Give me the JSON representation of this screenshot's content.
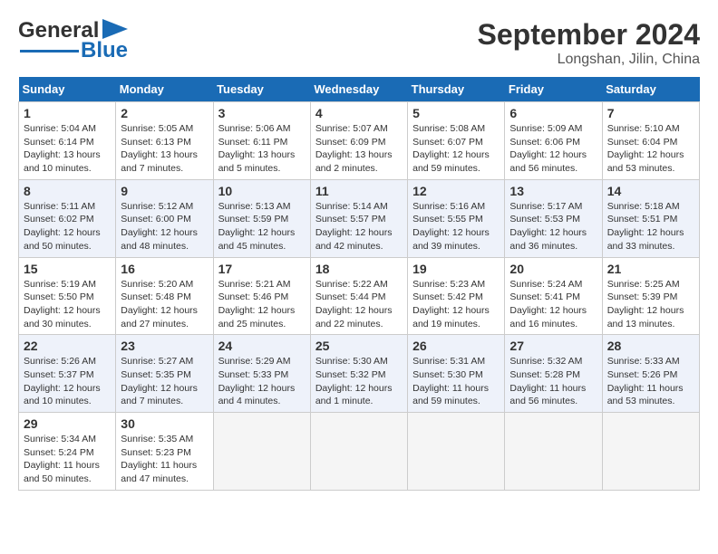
{
  "header": {
    "logo_main": "General",
    "logo_sub": "Blue",
    "month_title": "September 2024",
    "location": "Longshan, Jilin, China"
  },
  "days_of_week": [
    "Sunday",
    "Monday",
    "Tuesday",
    "Wednesday",
    "Thursday",
    "Friday",
    "Saturday"
  ],
  "weeks": [
    [
      {
        "day": 1,
        "info": "Sunrise: 5:04 AM\nSunset: 6:14 PM\nDaylight: 13 hours\nand 10 minutes."
      },
      {
        "day": 2,
        "info": "Sunrise: 5:05 AM\nSunset: 6:13 PM\nDaylight: 13 hours\nand 7 minutes."
      },
      {
        "day": 3,
        "info": "Sunrise: 5:06 AM\nSunset: 6:11 PM\nDaylight: 13 hours\nand 5 minutes."
      },
      {
        "day": 4,
        "info": "Sunrise: 5:07 AM\nSunset: 6:09 PM\nDaylight: 13 hours\nand 2 minutes."
      },
      {
        "day": 5,
        "info": "Sunrise: 5:08 AM\nSunset: 6:07 PM\nDaylight: 12 hours\nand 59 minutes."
      },
      {
        "day": 6,
        "info": "Sunrise: 5:09 AM\nSunset: 6:06 PM\nDaylight: 12 hours\nand 56 minutes."
      },
      {
        "day": 7,
        "info": "Sunrise: 5:10 AM\nSunset: 6:04 PM\nDaylight: 12 hours\nand 53 minutes."
      }
    ],
    [
      {
        "day": 8,
        "info": "Sunrise: 5:11 AM\nSunset: 6:02 PM\nDaylight: 12 hours\nand 50 minutes."
      },
      {
        "day": 9,
        "info": "Sunrise: 5:12 AM\nSunset: 6:00 PM\nDaylight: 12 hours\nand 48 minutes."
      },
      {
        "day": 10,
        "info": "Sunrise: 5:13 AM\nSunset: 5:59 PM\nDaylight: 12 hours\nand 45 minutes."
      },
      {
        "day": 11,
        "info": "Sunrise: 5:14 AM\nSunset: 5:57 PM\nDaylight: 12 hours\nand 42 minutes."
      },
      {
        "day": 12,
        "info": "Sunrise: 5:16 AM\nSunset: 5:55 PM\nDaylight: 12 hours\nand 39 minutes."
      },
      {
        "day": 13,
        "info": "Sunrise: 5:17 AM\nSunset: 5:53 PM\nDaylight: 12 hours\nand 36 minutes."
      },
      {
        "day": 14,
        "info": "Sunrise: 5:18 AM\nSunset: 5:51 PM\nDaylight: 12 hours\nand 33 minutes."
      }
    ],
    [
      {
        "day": 15,
        "info": "Sunrise: 5:19 AM\nSunset: 5:50 PM\nDaylight: 12 hours\nand 30 minutes."
      },
      {
        "day": 16,
        "info": "Sunrise: 5:20 AM\nSunset: 5:48 PM\nDaylight: 12 hours\nand 27 minutes."
      },
      {
        "day": 17,
        "info": "Sunrise: 5:21 AM\nSunset: 5:46 PM\nDaylight: 12 hours\nand 25 minutes."
      },
      {
        "day": 18,
        "info": "Sunrise: 5:22 AM\nSunset: 5:44 PM\nDaylight: 12 hours\nand 22 minutes."
      },
      {
        "day": 19,
        "info": "Sunrise: 5:23 AM\nSunset: 5:42 PM\nDaylight: 12 hours\nand 19 minutes."
      },
      {
        "day": 20,
        "info": "Sunrise: 5:24 AM\nSunset: 5:41 PM\nDaylight: 12 hours\nand 16 minutes."
      },
      {
        "day": 21,
        "info": "Sunrise: 5:25 AM\nSunset: 5:39 PM\nDaylight: 12 hours\nand 13 minutes."
      }
    ],
    [
      {
        "day": 22,
        "info": "Sunrise: 5:26 AM\nSunset: 5:37 PM\nDaylight: 12 hours\nand 10 minutes."
      },
      {
        "day": 23,
        "info": "Sunrise: 5:27 AM\nSunset: 5:35 PM\nDaylight: 12 hours\nand 7 minutes."
      },
      {
        "day": 24,
        "info": "Sunrise: 5:29 AM\nSunset: 5:33 PM\nDaylight: 12 hours\nand 4 minutes."
      },
      {
        "day": 25,
        "info": "Sunrise: 5:30 AM\nSunset: 5:32 PM\nDaylight: 12 hours\nand 1 minute."
      },
      {
        "day": 26,
        "info": "Sunrise: 5:31 AM\nSunset: 5:30 PM\nDaylight: 11 hours\nand 59 minutes."
      },
      {
        "day": 27,
        "info": "Sunrise: 5:32 AM\nSunset: 5:28 PM\nDaylight: 11 hours\nand 56 minutes."
      },
      {
        "day": 28,
        "info": "Sunrise: 5:33 AM\nSunset: 5:26 PM\nDaylight: 11 hours\nand 53 minutes."
      }
    ],
    [
      {
        "day": 29,
        "info": "Sunrise: 5:34 AM\nSunset: 5:24 PM\nDaylight: 11 hours\nand 50 minutes."
      },
      {
        "day": 30,
        "info": "Sunrise: 5:35 AM\nSunset: 5:23 PM\nDaylight: 11 hours\nand 47 minutes."
      },
      null,
      null,
      null,
      null,
      null
    ]
  ]
}
